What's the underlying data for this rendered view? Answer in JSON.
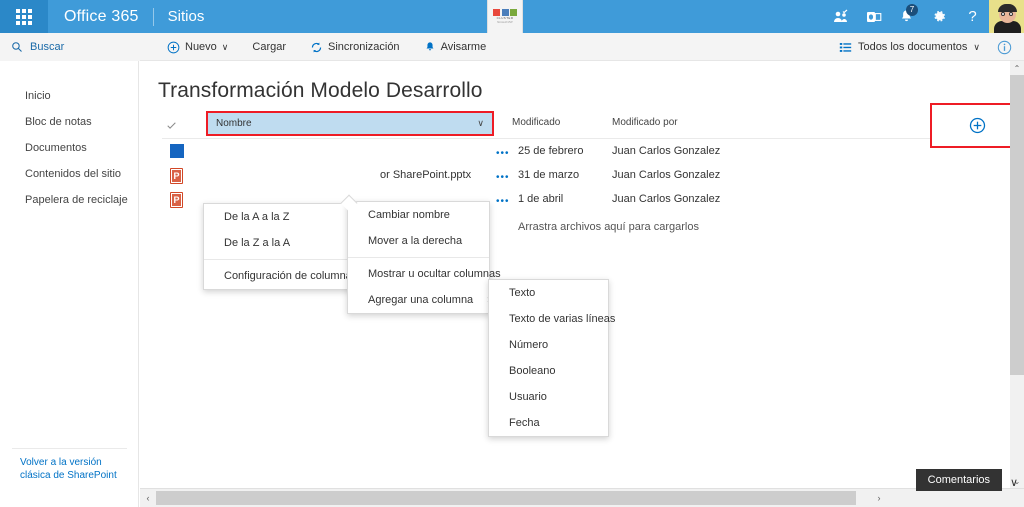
{
  "suitebar": {
    "app_launcher": "waffle-icon",
    "brand": "Office 365",
    "site": "Sitios",
    "logo_alt": "MVP Cluster",
    "logo_text": "CLUSTER",
    "logo_subtext": "Microsoft MVP",
    "icons": [
      {
        "name": "my-apps-icon",
        "glyph": "apps"
      },
      {
        "name": "outlook-icon",
        "glyph": "outlook"
      },
      {
        "name": "notifications-icon",
        "glyph": "bell",
        "badge": "7"
      },
      {
        "name": "settings-gear-icon",
        "glyph": "gear"
      },
      {
        "name": "help-icon",
        "glyph": "?"
      }
    ],
    "avatar": "user-avatar"
  },
  "commandbar": {
    "search_label": "Buscar",
    "search_icon": "search-icon",
    "items": [
      {
        "label": "Nuevo",
        "icon": "plus-circle-icon",
        "caret": "∨"
      },
      {
        "label": "Cargar",
        "icon": ""
      },
      {
        "label": "Sincronización",
        "icon": "sync-icon"
      },
      {
        "label": "Avisarme",
        "icon": "bell-icon"
      }
    ],
    "view_label": "Todos los documentos",
    "view_icon": "list-view-icon",
    "view_caret": "∨",
    "info_icon": "info-icon"
  },
  "sidebar": {
    "items": [
      {
        "label": "Inicio"
      },
      {
        "label": "Bloc de notas"
      },
      {
        "label": "Documentos"
      },
      {
        "label": "Contenidos del sitio"
      },
      {
        "label": "Papelera de reciclaje"
      }
    ],
    "classic_link": "Volver a la versión clásica de SharePoint"
  },
  "main": {
    "title": "Transformación Modelo Desarrollo",
    "columns": {
      "select_all_icon": "checkmark-icon",
      "name": "Nombre",
      "name_caret": "∨",
      "modified": "Modificado",
      "modified_by": "Modificado por",
      "add_column_icon": "add-column-icon"
    },
    "rows": [
      {
        "name": "",
        "icon": "blue-file-icon",
        "modified": "25 de febrero",
        "modified_by": "Juan Carlos Gonzalez",
        "dots": "•••"
      },
      {
        "name": "or SharePoint.pptx",
        "icon": "powerpoint-icon",
        "modified": "31 de marzo",
        "modified_by": "Juan Carlos Gonzalez",
        "dots": "•••"
      },
      {
        "name": "",
        "icon": "powerpoint-icon",
        "modified": "1 de abril",
        "modified_by": "Juan Carlos Gonzalez",
        "dots": "•••"
      }
    ],
    "dropzone": "Arrastra archivos aquí para cargarlos"
  },
  "menus": {
    "column_menu": {
      "items": [
        {
          "label": "De la A a la Z",
          "chevron": ""
        },
        {
          "label": "De la Z a la A",
          "chevron": ""
        },
        {
          "label": "Configuración de columnas",
          "chevron": "›"
        }
      ]
    },
    "column_settings_menu": {
      "items": [
        {
          "label": "Cambiar nombre",
          "chevron": ""
        },
        {
          "label": "Mover a la derecha",
          "chevron": ""
        },
        {
          "label": "Mostrar u ocultar columnas",
          "chevron": ""
        },
        {
          "label": "Agregar una columna",
          "chevron": "›"
        }
      ]
    },
    "add_column_menu": {
      "items": [
        {
          "label": "Texto"
        },
        {
          "label": "Texto de varias líneas"
        },
        {
          "label": "Número"
        },
        {
          "label": "Booleano"
        },
        {
          "label": "Usuario"
        },
        {
          "label": "Fecha"
        }
      ]
    }
  },
  "footer": {
    "comments_label": "Comentarios",
    "comments_chevron": "∨",
    "hscroll_left": "‹",
    "hscroll_right": "›",
    "vscroll_up": "⌃",
    "vscroll_down": "⌄"
  },
  "colors": {
    "suitebar_blue": "#3f9bd9",
    "waffle_blue": "#2b88c8",
    "accent_link": "#0072c6",
    "highlight_red": "#ee1c25",
    "selected_col_fill": "#bfdcf0"
  }
}
